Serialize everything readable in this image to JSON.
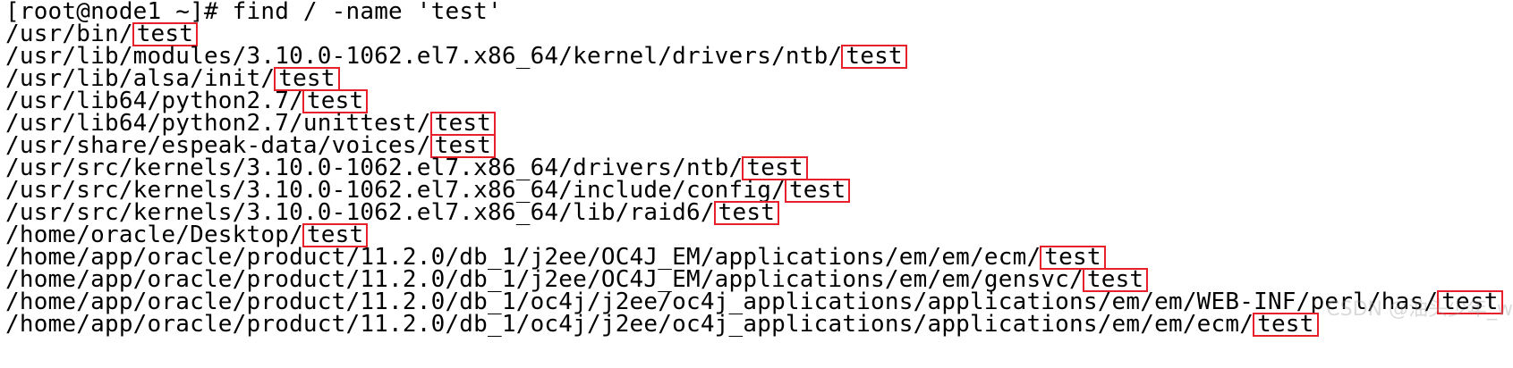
{
  "terminal": {
    "prompt": "[root@node1 ~]#",
    "command": " find / -name 'test'",
    "highlight_color": "#e8202a",
    "results": [
      {
        "dir": "/usr/bin/",
        "name": "test"
      },
      {
        "dir": "/usr/lib/modules/3.10.0-1062.el7.x86_64/kernel/drivers/ntb/",
        "name": "test"
      },
      {
        "dir": "/usr/lib/alsa/init/",
        "name": "test"
      },
      {
        "dir": "/usr/lib64/python2.7/",
        "name": "test"
      },
      {
        "dir": "/usr/lib64/python2.7/unittest/",
        "name": "test"
      },
      {
        "dir": "/usr/share/espeak-data/voices/",
        "name": "test"
      },
      {
        "dir": "/usr/src/kernels/3.10.0-1062.el7.x86_64/drivers/ntb/",
        "name": "test"
      },
      {
        "dir": "/usr/src/kernels/3.10.0-1062.el7.x86_64/include/config/",
        "name": "test"
      },
      {
        "dir": "/usr/src/kernels/3.10.0-1062.el7.x86_64/lib/raid6/",
        "name": "test"
      },
      {
        "dir": "/home/oracle/Desktop/",
        "name": "test"
      },
      {
        "dir": "/home/app/oracle/product/11.2.0/db_1/j2ee/OC4J_EM/applications/em/em/ecm/",
        "name": "test"
      },
      {
        "dir": "/home/app/oracle/product/11.2.0/db_1/j2ee/OC4J_EM/applications/em/em/gensvc/",
        "name": "test"
      },
      {
        "dir": "/home/app/oracle/product/11.2.0/db_1/oc4j/j2ee/oc4j_applications/applications/em/em/WEB-INF/perl/has/",
        "name": "test"
      },
      {
        "dir": "/home/app/oracle/product/11.2.0/db_1/oc4j/j2ee/oc4j_applications/applications/em/em/ecm/",
        "name": "test"
      }
    ]
  },
  "watermark": "CSDN @油头少年_w"
}
